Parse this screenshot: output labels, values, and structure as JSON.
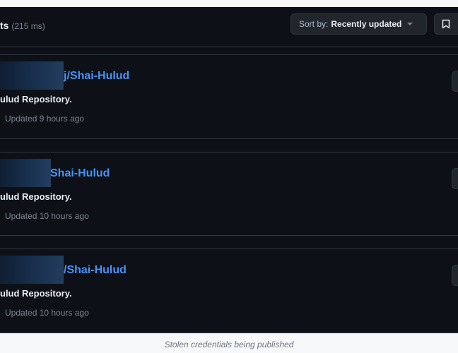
{
  "header": {
    "results_label": "ts",
    "results_timing": "(215 ms)",
    "sort_prefix": "Sort by:",
    "sort_value": "Recently updated"
  },
  "results": [
    {
      "name": "/Shai-Hulud",
      "name_visible_suffix": "j/Shai-Hulud",
      "description": "ulud Repository.",
      "updated": "Updated 9 hours ago"
    },
    {
      "name_visible_suffix": "Shai-Hulud",
      "description": "ulud Repository.",
      "updated": "Updated 10 hours ago"
    },
    {
      "name_visible_suffix": "/Shai-Hulud",
      "description": "ulud Repository.",
      "updated": "Updated 10 hours ago"
    }
  ],
  "caption": "Stolen credentials being published",
  "colors": {
    "background": "#0d1117",
    "link": "#4493f8",
    "text": "#e6edf3",
    "muted": "#7d8590",
    "border": "#30363d"
  }
}
